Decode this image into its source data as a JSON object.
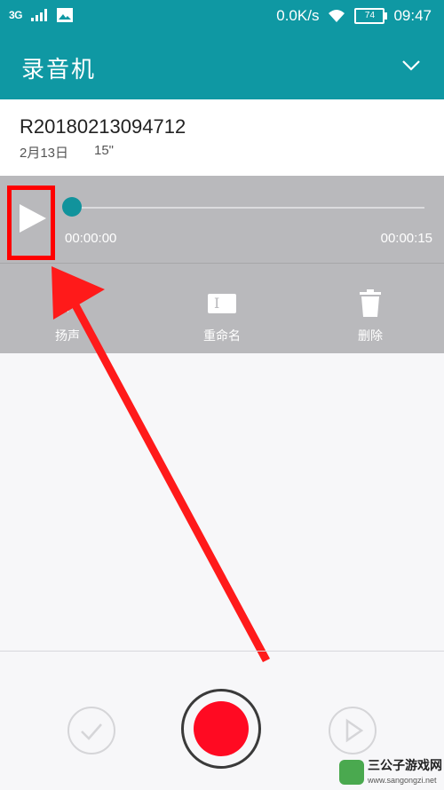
{
  "status_bar": {
    "network": "3G",
    "speed": "0.0K/s",
    "battery": "74",
    "time": "09:47",
    "icons": [
      "signal-icon",
      "image-icon",
      "wifi-icon",
      "battery-icon"
    ]
  },
  "app_bar": {
    "title": "录音机",
    "menu_icon": "chevron-down-icon"
  },
  "recording": {
    "name": "R20180213094712",
    "date": "2月13日",
    "duration": "15\""
  },
  "player": {
    "current_time": "00:00:00",
    "total_time": "00:00:15",
    "progress": 0,
    "actions": [
      {
        "label": "扬声",
        "icon": "speaker-icon"
      },
      {
        "label": "重命名",
        "icon": "rename-icon"
      },
      {
        "label": "删除",
        "icon": "trash-icon"
      }
    ]
  },
  "bottom_bar": {
    "icons": [
      "check-icon",
      "record-icon",
      "play-icon"
    ]
  },
  "watermark": {
    "title": "三公子游戏网",
    "url": "www.sangongzi.net"
  },
  "colors": {
    "accent": "#0f98a3",
    "record": "#ff0a22",
    "highlight": "#ff0000"
  }
}
